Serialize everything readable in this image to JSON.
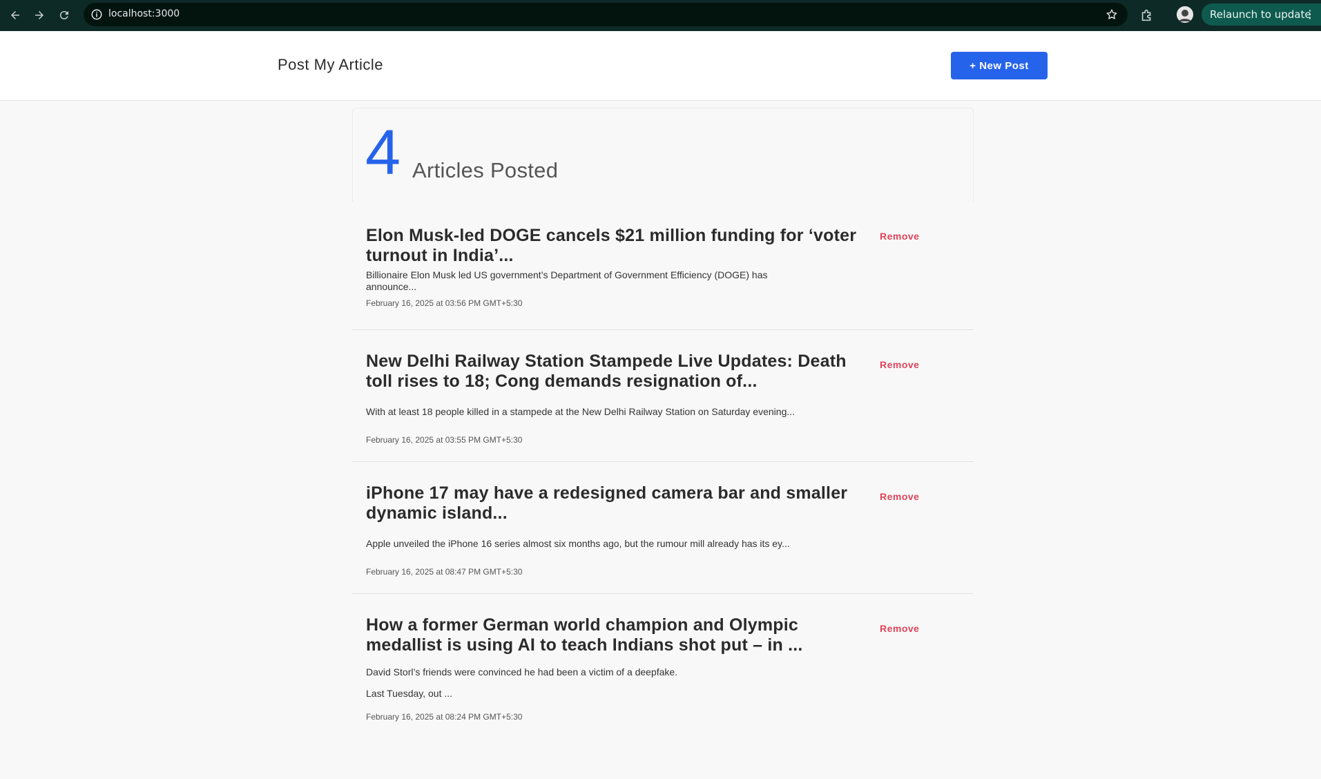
{
  "browser": {
    "url": "localhost:3000",
    "relaunch_label": "Relaunch to update"
  },
  "header": {
    "brand": "Post My Article",
    "new_post_label": "+ New Post"
  },
  "summary": {
    "count": "4",
    "label": "Articles Posted"
  },
  "articles": [
    {
      "title": "Elon Musk-led DOGE cancels $21 million funding for ‘voter turnout in India’...",
      "description": "Billionaire Elon Musk led US government’s Department of Government Efficiency (DOGE) has announce...",
      "description2": "",
      "date": "February 16, 2025 at 03:56 PM GMT+5:30",
      "remove_label": "Remove"
    },
    {
      "title": "New Delhi Railway Station Stampede Live Updates: Death toll rises to 18; Cong demands resignation of...",
      "description": "With at least 18 people killed in a stampede at the New Delhi Railway Station on Saturday evening...",
      "description2": "",
      "date": "February 16, 2025 at 03:55 PM GMT+5:30",
      "remove_label": "Remove"
    },
    {
      "title": "iPhone 17 may have a redesigned camera bar and smaller dynamic island...",
      "description": "Apple unveiled the iPhone 16 series almost six months ago, but the rumour mill already has its ey...",
      "description2": "",
      "date": "February 16, 2025 at 08:47 PM GMT+5:30",
      "remove_label": "Remove"
    },
    {
      "title": "How a former German world champion and Olympic medallist is using AI to teach Indians shot put – in ...",
      "description": "David Storl’s friends were convinced he had been a victim of a deepfake.",
      "description2": "Last Tuesday, out ...",
      "date": "February 16, 2025 at 08:24 PM GMT+5:30",
      "remove_label": "Remove"
    }
  ]
}
